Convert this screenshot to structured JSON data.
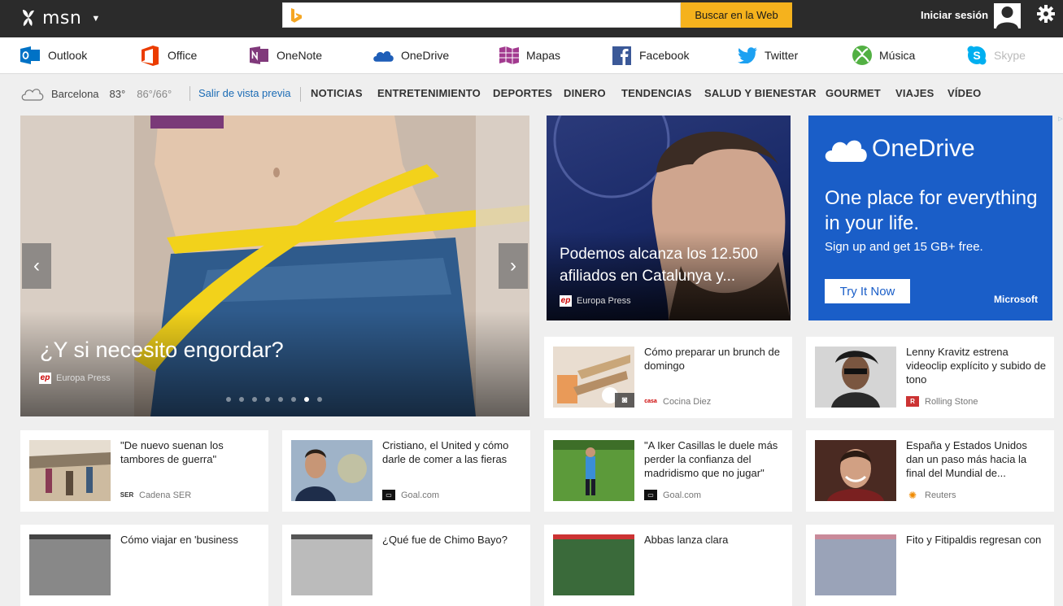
{
  "header": {
    "logo_text": "msn",
    "search_placeholder": "",
    "search_button": "Buscar en la Web",
    "signin": "Iniciar sesión"
  },
  "apps": [
    {
      "label": "Outlook",
      "icon": "outlook-icon",
      "color": "#0072c6"
    },
    {
      "label": "Office",
      "icon": "office-icon",
      "color": "#eb3c00"
    },
    {
      "label": "OneNote",
      "icon": "onenote-icon",
      "color": "#80397b"
    },
    {
      "label": "OneDrive",
      "icon": "onedrive-icon",
      "color": "#1e5eb8"
    },
    {
      "label": "Mapas",
      "icon": "maps-icon",
      "color": "#a23a8f"
    },
    {
      "label": "Facebook",
      "icon": "facebook-icon",
      "color": "#3b5998"
    },
    {
      "label": "Twitter",
      "icon": "twitter-icon",
      "color": "#1da1f2"
    },
    {
      "label": "Música",
      "icon": "xbox-music-icon",
      "color": "#52b043"
    },
    {
      "label": "Skype",
      "icon": "skype-icon",
      "color": "#00aff0"
    }
  ],
  "weather": {
    "city": "Barcelona",
    "temp": "83°",
    "range": "86°/66°"
  },
  "nav": {
    "exit_preview": "Salir de vista previa",
    "items": [
      "NOTICIAS",
      "ENTRETENIMIENTO",
      "DEPORTES",
      "DINERO",
      "TENDENCIAS",
      "SALUD Y BIENESTAR",
      "GOURMET",
      "VIAJES",
      "VÍDEO"
    ]
  },
  "hero": {
    "title": "¿Y si necesito engordar?",
    "source": "Europa Press",
    "slide_count": 8,
    "active_slide": 7
  },
  "news2": {
    "title": "Podemos alcanza los 12.500 afiliados en Catalunya y...",
    "source": "Europa Press"
  },
  "ad": {
    "brand": "OneDrive",
    "headline": "One place for everything in your life.",
    "sub": "Sign up and get 15 GB+ free.",
    "cta": "Try It Now",
    "company": "Microsoft"
  },
  "small_cards": [
    {
      "title": "Cómo preparar un brunch de domingo",
      "source": "Cocina Diez"
    },
    {
      "title": "Lenny Kravitz estrena videoclip explícito y subido de tono",
      "source": "Rolling Stone"
    },
    {
      "title": "\"De nuevo suenan los tambores de guerra\"",
      "source": "Cadena SER"
    },
    {
      "title": "Cristiano, el United y cómo darle de comer a las fieras",
      "source": "Goal.com"
    },
    {
      "title": "\"A Iker Casillas le duele más perder la confianza del madridismo que no jugar\"",
      "source": "Goal.com"
    },
    {
      "title": "España y Estados Unidos dan un paso más hacia la final del Mundial de...",
      "source": "Reuters"
    },
    {
      "title": "Cómo viajar en 'business",
      "source": ""
    },
    {
      "title": "¿Qué fue de Chimo Bayo?",
      "source": ""
    },
    {
      "title": "Abbas lanza clara",
      "source": ""
    },
    {
      "title": "Fito y Fitipaldis regresan con",
      "source": ""
    }
  ]
}
